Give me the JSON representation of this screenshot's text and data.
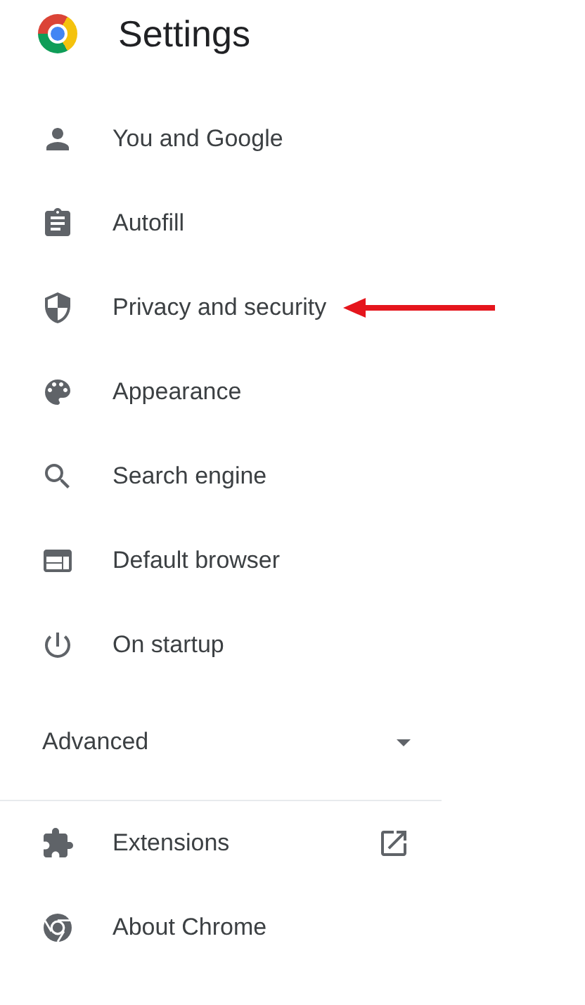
{
  "header": {
    "title": "Settings"
  },
  "menu": [
    {
      "label": "You and Google",
      "kind": "person",
      "highlighted": false
    },
    {
      "label": "Autofill",
      "kind": "clipboard",
      "highlighted": false
    },
    {
      "label": "Privacy and security",
      "kind": "shield",
      "highlighted": true
    },
    {
      "label": "Appearance",
      "kind": "palette",
      "highlighted": false
    },
    {
      "label": "Search engine",
      "kind": "search",
      "highlighted": false
    },
    {
      "label": "Default browser",
      "kind": "browser",
      "highlighted": false
    },
    {
      "label": "On startup",
      "kind": "power",
      "highlighted": false
    }
  ],
  "advanced": {
    "label": "Advanced",
    "expanded": false
  },
  "bottom_menu": [
    {
      "label": "Extensions",
      "kind": "puzzle",
      "external": true
    },
    {
      "label": "About Chrome",
      "kind": "chrome",
      "external": false
    }
  ]
}
